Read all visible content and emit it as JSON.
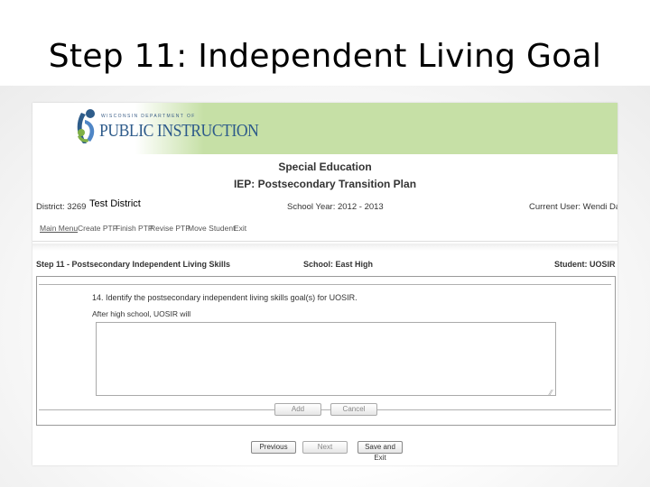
{
  "slide": {
    "title": "Step 11: Independent Living Goal"
  },
  "banner": {
    "department_text": "WISCONSIN DEPARTMENT OF",
    "main_text": "PUBLIC INSTRUCTION",
    "logo_icon": "dpi-family-logo-icon",
    "color": "#c6e0a6"
  },
  "header": {
    "title_line1": "Special Education",
    "title_line2": "IEP: Postsecondary Transition Plan"
  },
  "info": {
    "district_label": "District: 3269",
    "district_name": "Test District",
    "school_year": "School Year: 2012 - 2013",
    "current_user": "Current User: Wendi Dawson"
  },
  "nav": {
    "items": [
      {
        "label": "Main Menu"
      },
      {
        "label": "Create PTP"
      },
      {
        "label": "Finish PTP"
      },
      {
        "label": "Revise PTP"
      },
      {
        "label": "Move Student"
      },
      {
        "label": "Exit"
      }
    ]
  },
  "step_bar": {
    "step": "Step 11 - Postsecondary Independent Living Skills",
    "school": "School: East High",
    "student": "Student: UOSIR TAGOE"
  },
  "form": {
    "question": "14. Identify the postsecondary independent living skills goal(s) for UOSIR.",
    "prompt": "After high school, UOSIR will",
    "textarea_value": "",
    "add_label": "Add",
    "cancel_label": "Cancel"
  },
  "footer": {
    "previous_label": "Previous",
    "next_label": "Next",
    "save_exit_label": "Save and Exit"
  }
}
